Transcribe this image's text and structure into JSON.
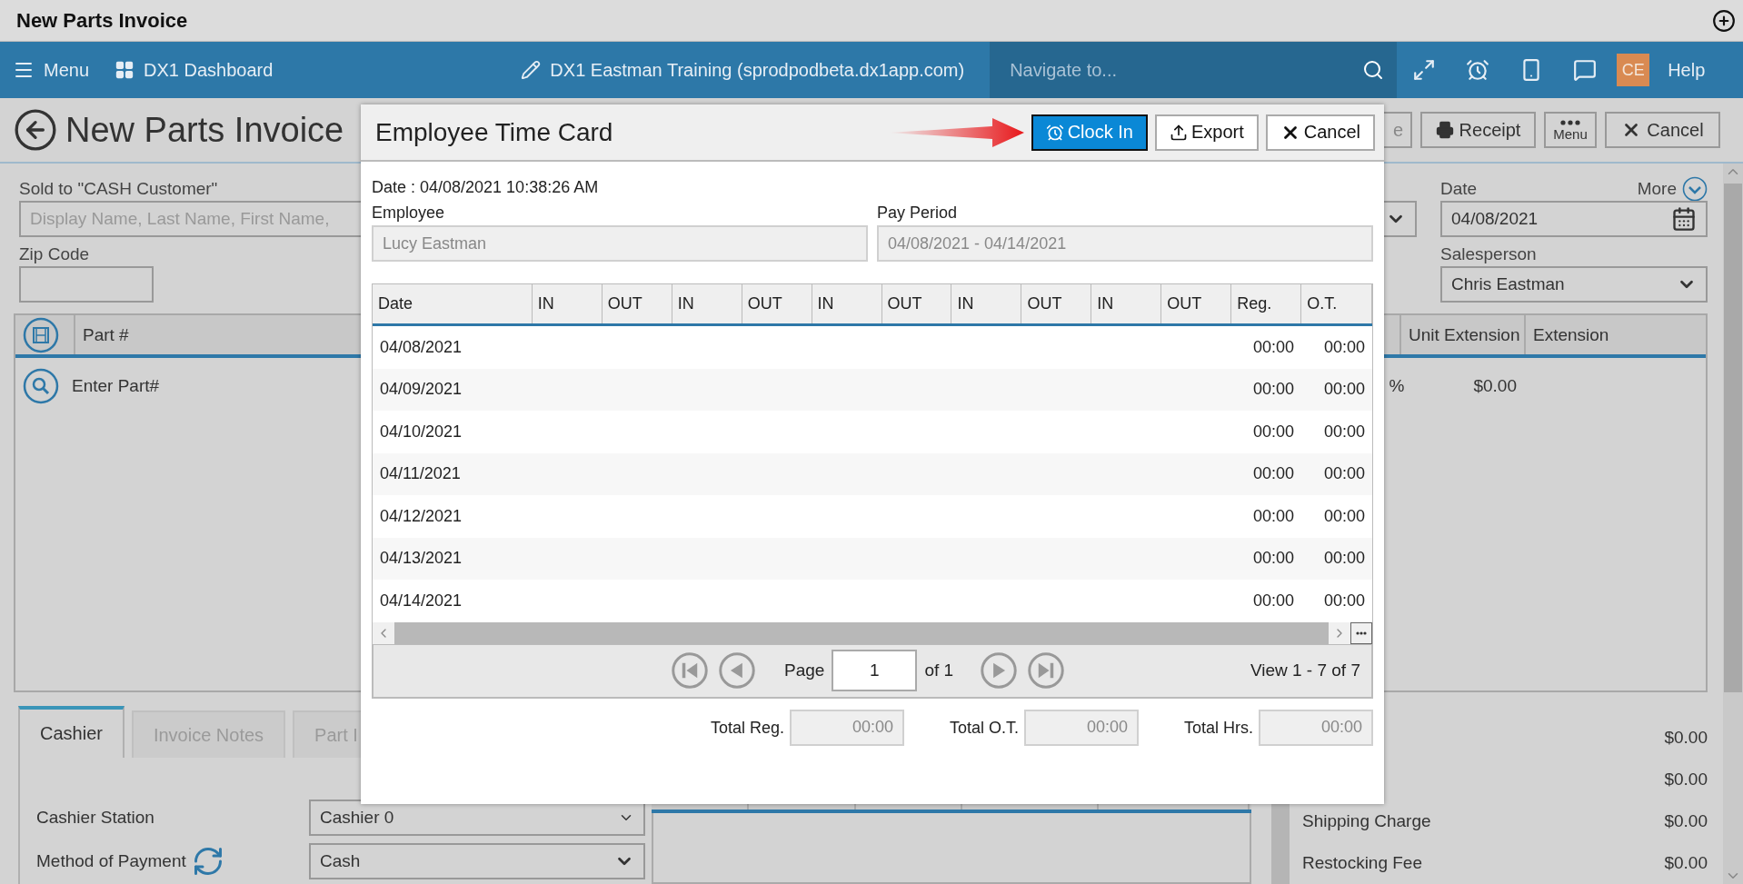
{
  "title_bar": {
    "title": "New Parts Invoice"
  },
  "nav": {
    "menu": "Menu",
    "dashboard": "DX1 Dashboard",
    "site": "DX1 Eastman Training (sprodpodbeta.dx1app.com)",
    "navigate_placeholder": "Navigate to...",
    "avatar": "CE",
    "help": "Help"
  },
  "page": {
    "title": "New Parts Invoice",
    "actions": [
      {
        "label": "e",
        "kind": "plain"
      },
      {
        "label": "Receipt",
        "kind": "print"
      },
      {
        "label": "Menu",
        "kind": "more"
      },
      {
        "label": "Cancel",
        "kind": "cancel"
      }
    ]
  },
  "customer": {
    "sold_to_label": "Sold to  \"CASH Customer\"",
    "search_placeholder": "Display Name, Last Name, First Name,",
    "zip_label": "Zip Code"
  },
  "details": {
    "date_label": "Date",
    "more": "More",
    "date": "04/08/2021",
    "salesperson_label": "Salesperson",
    "salesperson": "Chris Eastman"
  },
  "parts_grid": {
    "columns": [
      "Part #",
      "Unit Extension",
      "Extension"
    ],
    "entry_placeholder": "Enter Part#",
    "percent": "%",
    "unit_extension": "$0.00"
  },
  "bottom_tabs": [
    {
      "label": "Cashier",
      "selected": true
    },
    {
      "label": "Invoice Notes",
      "selected": false
    },
    {
      "label": "Part I",
      "selected": false
    }
  ],
  "cashier": {
    "station_label": "Cashier Station",
    "station": "Cashier 0",
    "payment_label": "Method of Payment",
    "payment": "Cash"
  },
  "totals": [
    {
      "value": "$0.00"
    },
    {
      "value": "$0.00"
    },
    {
      "label": "Shipping Charge",
      "value": "$0.00"
    },
    {
      "label": "Restocking Fee",
      "value": "$0.00"
    }
  ],
  "dialog": {
    "title": "Employee Time Card",
    "buttons": [
      {
        "label": "Clock In",
        "kind": "clock"
      },
      {
        "label": "Export",
        "kind": "export"
      },
      {
        "label": "Cancel",
        "kind": "cancel"
      }
    ],
    "date_line": "Date : 04/08/2021 10:38:26 AM",
    "employee_label": "Employee",
    "employee": "Lucy Eastman",
    "pay_period_label": "Pay Period",
    "pay_period": "04/08/2021 - 04/14/2021",
    "columns": [
      "Date",
      "IN",
      "OUT",
      "IN",
      "OUT",
      "IN",
      "OUT",
      "IN",
      "OUT",
      "IN",
      "OUT",
      "Reg.",
      "O.T."
    ],
    "rows": [
      {
        "date": "04/08/2021",
        "reg": "00:00",
        "ot": "00:00"
      },
      {
        "date": "04/09/2021",
        "reg": "00:00",
        "ot": "00:00"
      },
      {
        "date": "04/10/2021",
        "reg": "00:00",
        "ot": "00:00"
      },
      {
        "date": "04/11/2021",
        "reg": "00:00",
        "ot": "00:00"
      },
      {
        "date": "04/12/2021",
        "reg": "00:00",
        "ot": "00:00"
      },
      {
        "date": "04/13/2021",
        "reg": "00:00",
        "ot": "00:00"
      },
      {
        "date": "04/14/2021",
        "reg": "00:00",
        "ot": "00:00"
      }
    ],
    "pager": {
      "page_label": "Page",
      "page": "1",
      "of": "of 1",
      "view": "View 1 - 7 of 7"
    },
    "totals": [
      {
        "label": "Total Reg.",
        "value": "00:00"
      },
      {
        "label": "Total O.T.",
        "value": "00:00"
      },
      {
        "label": "Total Hrs.",
        "value": "00:00"
      }
    ]
  }
}
